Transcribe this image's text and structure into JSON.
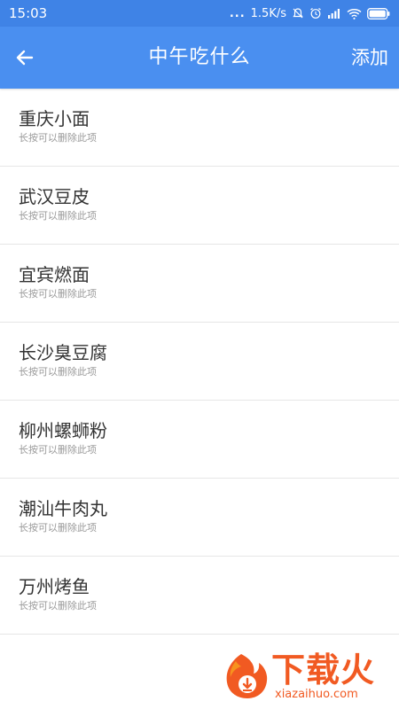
{
  "status_bar": {
    "time": "15:03",
    "network_speed": "1.5K/s",
    "dots": "...",
    "icons": [
      "mute-bell-icon",
      "alarm-icon",
      "signal-icon",
      "wifi-icon",
      "battery-icon"
    ]
  },
  "app_bar": {
    "title": "中午吃什么",
    "add_label": "添加",
    "back_icon": "arrow-left-icon",
    "background": "#4a8ff0"
  },
  "items": [
    {
      "title": "重庆小面",
      "subtitle": "长按可以删除此项"
    },
    {
      "title": "武汉豆皮",
      "subtitle": "长按可以删除此项"
    },
    {
      "title": "宜宾燃面",
      "subtitle": "长按可以删除此项"
    },
    {
      "title": "长沙臭豆腐",
      "subtitle": "长按可以删除此项"
    },
    {
      "title": "柳州螺蛳粉",
      "subtitle": "长按可以删除此项"
    },
    {
      "title": "潮汕牛肉丸",
      "subtitle": "长按可以删除此项"
    },
    {
      "title": "万州烤鱼",
      "subtitle": "长按可以删除此项"
    }
  ],
  "watermark": {
    "brand": "下载火",
    "url": "xiazaihuo.com",
    "color": "#f15a22"
  }
}
